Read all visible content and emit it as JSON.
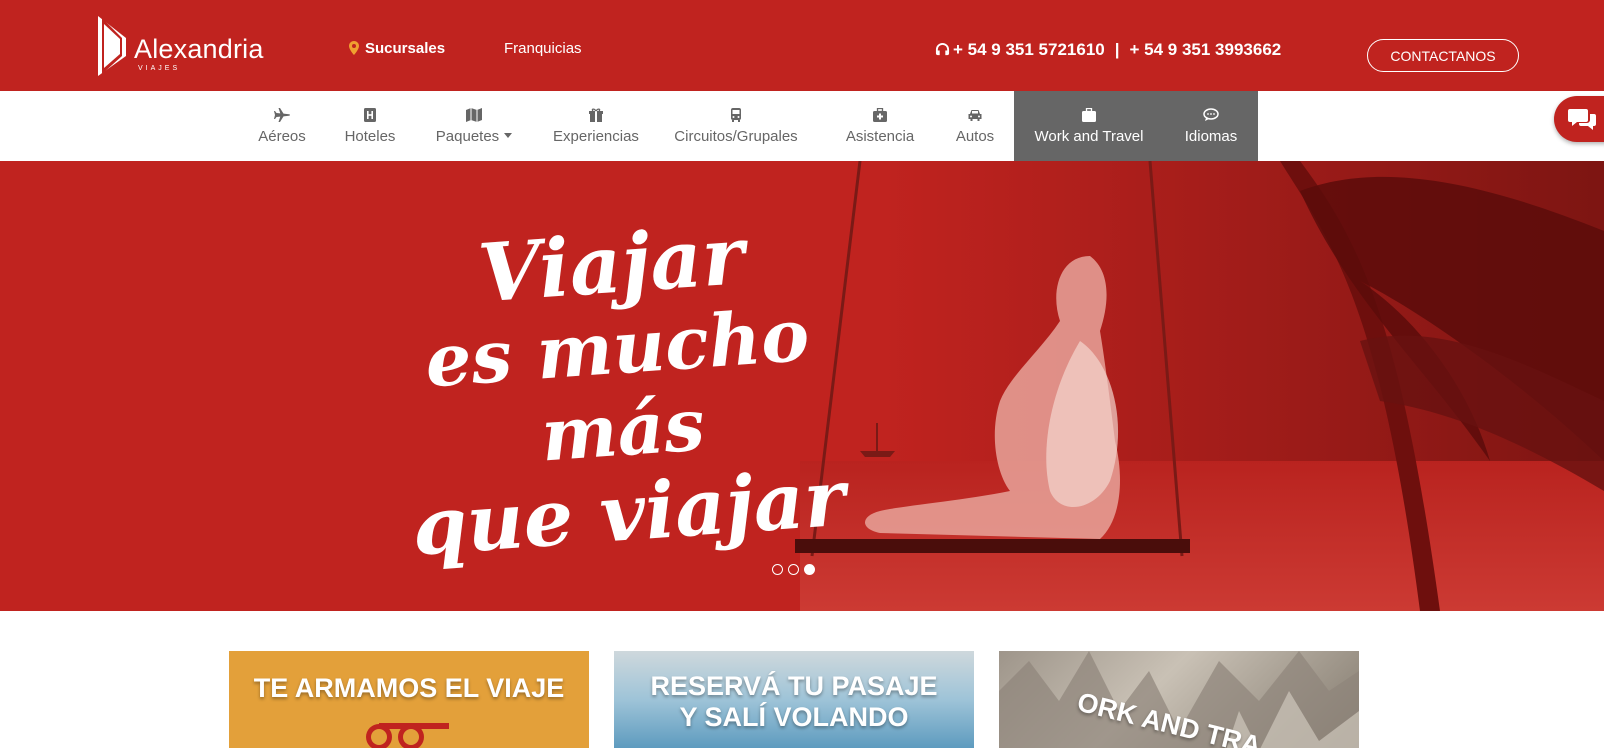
{
  "header": {
    "brand_name": "Alexandria",
    "brand_sub": "VIAJES",
    "nav": {
      "sucursales": "Sucursales",
      "franquicias": "Franquicias"
    },
    "phone1": "+ 54 9 351 5721610",
    "phone_sep": "|",
    "phone2": "+ 54 9 351 3993662",
    "contact_button": "CONTACTANOS"
  },
  "mainnav": {
    "items": [
      {
        "label": "Aéreos",
        "icon": "plane-icon"
      },
      {
        "label": "Hoteles",
        "icon": "hotel-icon"
      },
      {
        "label": "Paquetes",
        "icon": "map-icon"
      },
      {
        "label": "Experiencias",
        "icon": "gift-icon"
      },
      {
        "label": "Circuitos/Grupales",
        "icon": "bus-icon"
      },
      {
        "label": "Asistencia",
        "icon": "medkit-icon"
      },
      {
        "label": "Autos",
        "icon": "car-icon"
      },
      {
        "label": "Work and Travel",
        "icon": "briefcase-icon"
      },
      {
        "label": "Idiomas",
        "icon": "chat-bubble-icon"
      }
    ]
  },
  "hero": {
    "line1": "Viajar",
    "line2": "es mucho más",
    "line3": "que viajar",
    "slides": 3,
    "active_slide": 3
  },
  "cards": [
    {
      "title_line1": "TE ARMAMOS EL VIAJE",
      "title_line2": ""
    },
    {
      "title_line1": "RESERVÁ TU PASAJE",
      "title_line2": "Y SALÍ VOLANDO"
    },
    {
      "title_line1": "ORK AND TRA",
      "title_line2": ""
    }
  ],
  "colors": {
    "brand_red": "#c0231f",
    "nav_dark": "#666666",
    "pin_orange": "#f0a030",
    "card_orange": "#e3a03a"
  }
}
